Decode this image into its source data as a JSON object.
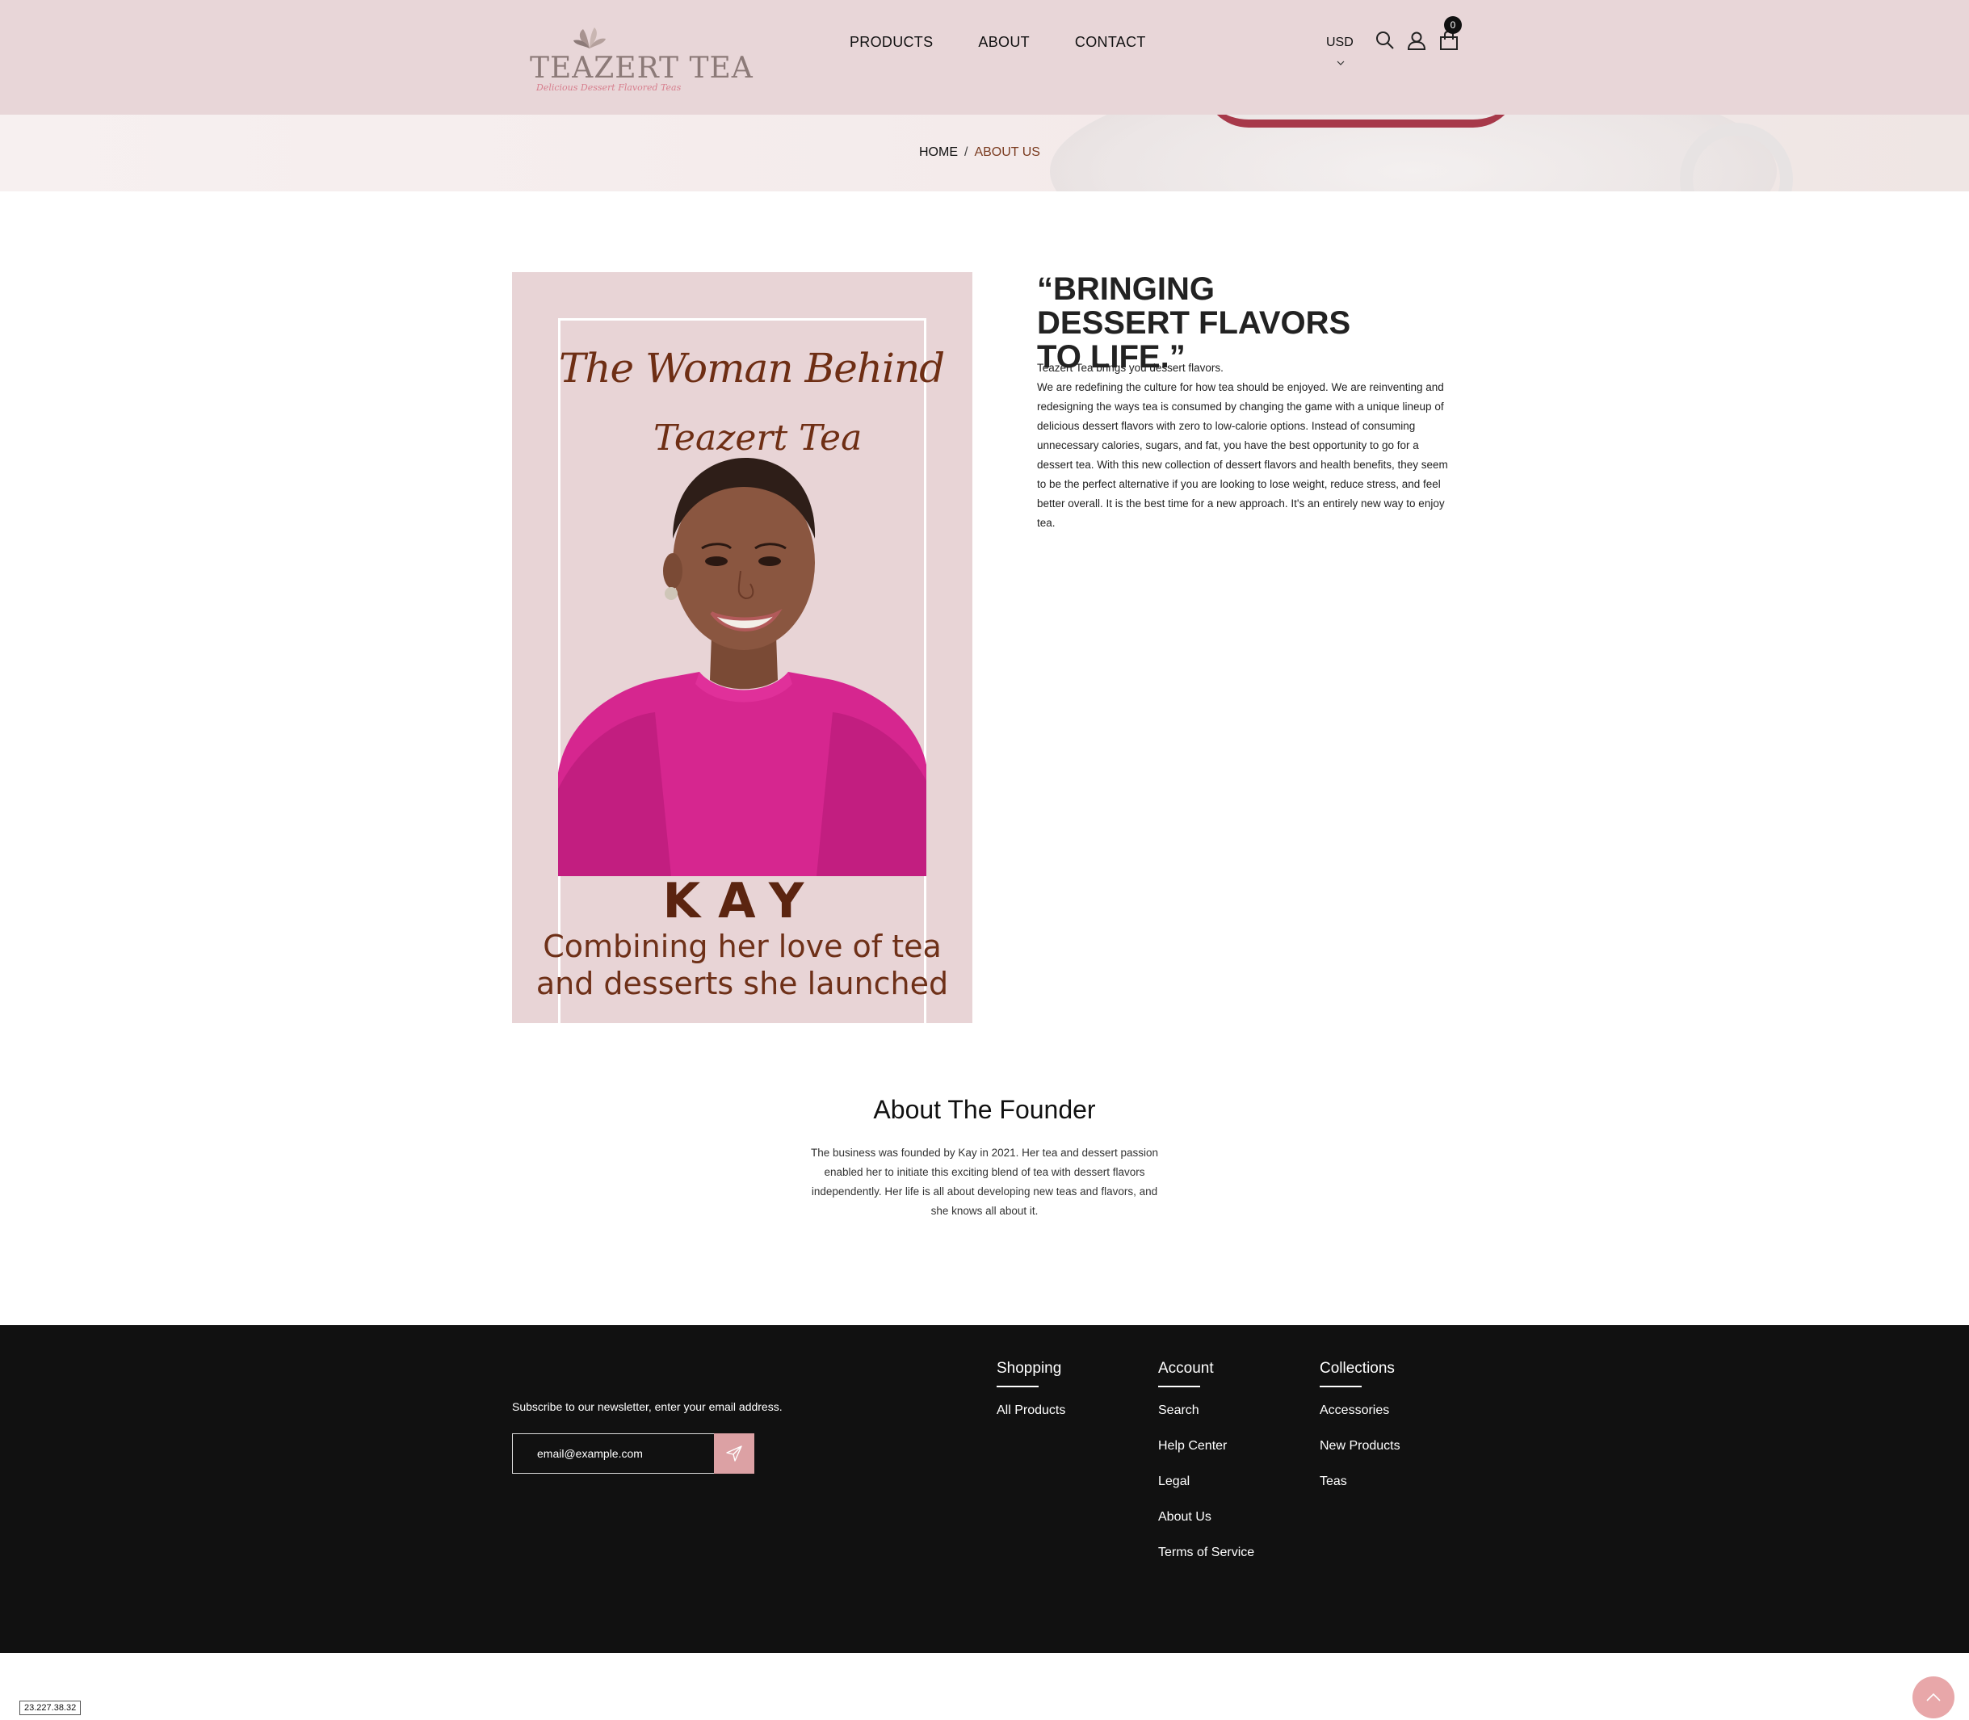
{
  "header": {
    "logo_text": "TEAZERT TEA",
    "logo_tagline": "Delicious Dessert Flavored Teas",
    "nav": [
      {
        "label": "PRODUCTS"
      },
      {
        "label": "ABOUT"
      },
      {
        "label": "CONTACT"
      }
    ],
    "currency": "USD",
    "cart_count": "0"
  },
  "breadcrumb": {
    "home": "HOME",
    "separator": "/",
    "current": "ABOUT US"
  },
  "feature_image": {
    "line1": "The Woman Behind",
    "line2": "Teazert Tea",
    "name": "KAY",
    "caption_line1": "Combining her love of tea",
    "caption_line2": "and desserts she launched"
  },
  "about": {
    "quote": "“BRINGING DESSERT FLAVORS TO LIFE.”",
    "intro_line": "Teazert Tea brings you dessert flavors.",
    "intro_body": "We are redefining the culture for how tea should be enjoyed. We are reinventing and redesigning the ways tea is consumed by changing the game with a unique lineup of delicious dessert flavors with zero to low-calorie options. Instead of consuming unnecessary calories, sugars, and fat, you have the best opportunity to go for a dessert tea. With this new collection of dessert flavors and health benefits, they seem to be the perfect alternative if you are looking to lose weight, reduce stress, and feel better overall. It is the best time for a new approach. It's an entirely new way to enjoy tea."
  },
  "founder": {
    "title": "About The Founder",
    "text": "The business was founded by Kay in 2021. Her tea and dessert passion enabled her to initiate this exciting blend of tea with dessert flavors independently. Her life is all about developing new teas and flavors, and she knows all about it."
  },
  "footer": {
    "newsletter_label": "Subscribe to our newsletter, enter your email address.",
    "newsletter_placeholder": "email@example.com",
    "columns": [
      {
        "title": "Shopping",
        "links": [
          "All Products"
        ]
      },
      {
        "title": "Account",
        "links": [
          "Search",
          "Help Center",
          "Legal",
          "About Us",
          "Terms of Service"
        ]
      },
      {
        "title": "Collections",
        "links": [
          "Accessories",
          "New Products",
          "Teas"
        ]
      }
    ]
  },
  "ip_badge": "23.227.38.32",
  "colors": {
    "header_bg": "#e8d6d8",
    "footer_bg": "#111111",
    "accent_pink": "#dca1a4",
    "breadcrumb_active": "#7a3b1f"
  }
}
